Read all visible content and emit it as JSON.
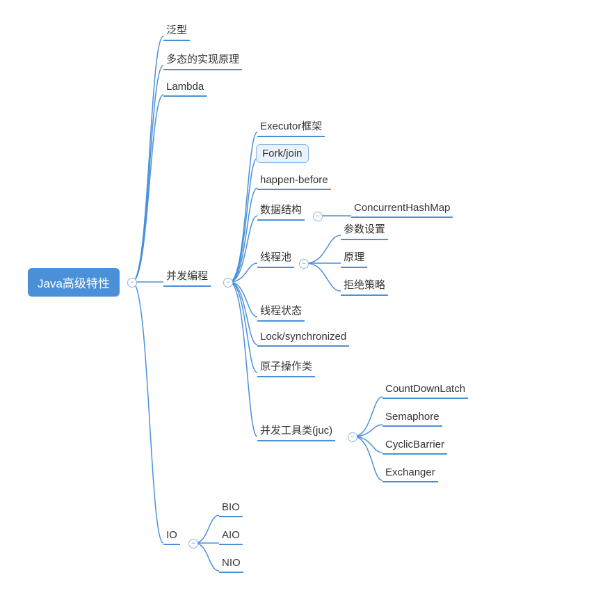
{
  "chart_data": {
    "type": "mindmap",
    "root": "Java高级特性",
    "children": [
      {
        "label": "泛型"
      },
      {
        "label": "多态的实现原理"
      },
      {
        "label": "Lambda"
      },
      {
        "label": "并发编程",
        "children": [
          {
            "label": "Executor框架"
          },
          {
            "label": "Fork/join",
            "highlighted": true
          },
          {
            "label": "happen-before"
          },
          {
            "label": "数据结构",
            "children": [
              {
                "label": "ConcurrentHashMap"
              }
            ]
          },
          {
            "label": "线程池",
            "children": [
              {
                "label": "参数设置"
              },
              {
                "label": "原理"
              },
              {
                "label": "拒绝策略"
              }
            ]
          },
          {
            "label": "线程状态"
          },
          {
            "label": "Lock/synchronized"
          },
          {
            "label": "原子操作类"
          },
          {
            "label": "并发工具类(juc)",
            "children": [
              {
                "label": "CountDownLatch"
              },
              {
                "label": "Semaphore"
              },
              {
                "label": "CyclicBarrier"
              },
              {
                "label": "Exchanger"
              }
            ]
          }
        ]
      },
      {
        "label": "IO",
        "children": [
          {
            "label": "BIO"
          },
          {
            "label": "AIO"
          },
          {
            "label": "NIO"
          }
        ]
      }
    ]
  },
  "root": {
    "label": "Java高级特性"
  },
  "l1": {
    "generics": "泛型",
    "polymorphism": "多态的实现原理",
    "lambda": "Lambda",
    "concurrency": "并发编程",
    "io": "IO"
  },
  "concurrency": {
    "executor": "Executor框架",
    "forkjoin": "Fork/join",
    "happenbefore": "happen-before",
    "datastruct": "数据结构",
    "threadpool": "线程池",
    "threadstate": "线程状态",
    "locksync": "Lock/synchronized",
    "atomic": "原子操作类",
    "juc": "并发工具类(juc)"
  },
  "datastruct": {
    "chashmap": "ConcurrentHashMap"
  },
  "threadpool": {
    "params": "参数设置",
    "principle": "原理",
    "reject": "拒绝策略"
  },
  "juc": {
    "cdl": "CountDownLatch",
    "sem": "Semaphore",
    "cb": "CyclicBarrier",
    "ex": "Exchanger"
  },
  "io": {
    "bio": "BIO",
    "aio": "AIO",
    "nio": "NIO"
  },
  "toggle": {
    "minus": "−"
  }
}
